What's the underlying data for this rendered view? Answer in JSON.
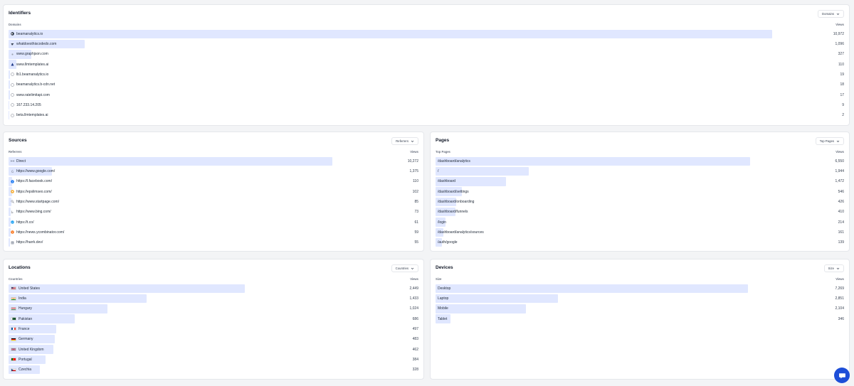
{
  "identifiers": {
    "title": "Identifiers",
    "dropdown": "Domains",
    "col_left": "Domains",
    "col_right": "Views",
    "max": 12000,
    "rows": [
      {
        "label": "beamanalytics.io",
        "value": "10,972",
        "num": 10972,
        "icon": "beam-logo-icon"
      },
      {
        "label": "whatdoesthiscodedo.com",
        "value": "1,096",
        "num": 1096,
        "icon": "whatdoesthiscodedo-logo-icon"
      },
      {
        "label": "www.graphjson.com",
        "value": "327",
        "num": 327,
        "icon": "graphjson-logo-icon"
      },
      {
        "label": "www.llmtemplates.ai",
        "value": "110",
        "num": 110,
        "icon": "llmtemplates-logo-icon"
      },
      {
        "label": "lb1.beamanalytics.io",
        "value": "19",
        "num": 19,
        "icon": "globe-icon"
      },
      {
        "label": "beamanalytics.b-cdn.net",
        "value": "18",
        "num": 18,
        "icon": "globe-icon"
      },
      {
        "label": "www.ratelimitapi.com",
        "value": "17",
        "num": 17,
        "icon": "globe-icon"
      },
      {
        "label": "167.233.14.205",
        "value": "9",
        "num": 9,
        "icon": "globe-icon"
      },
      {
        "label": "beta.llmtemplates.ai",
        "value": "2",
        "num": 2,
        "icon": "globe-icon"
      }
    ]
  },
  "sources": {
    "title": "Sources",
    "dropdown": "Referrers",
    "col_left": "Referrers",
    "col_right": "Views",
    "max": 13000,
    "rows": [
      {
        "label": "Direct",
        "value": "10,272",
        "num": 10272,
        "icon": "link-icon"
      },
      {
        "label": "https://www.google.com/",
        "value": "1,375",
        "num": 1375,
        "icon": "google-icon"
      },
      {
        "label": "https://l.facebook.com/",
        "value": "110",
        "num": 110,
        "icon": "facebook-icon"
      },
      {
        "label": "https://epslimseo.com/",
        "value": "102",
        "num": 102,
        "icon": "epslimseo-icon"
      },
      {
        "label": "https://www.startpage.com/",
        "value": "85",
        "num": 85,
        "icon": "startpage-icon"
      },
      {
        "label": "https://www.bing.com/",
        "value": "73",
        "num": 73,
        "icon": "bing-icon"
      },
      {
        "label": "https://t.co/",
        "value": "61",
        "num": 61,
        "icon": "twitter-icon"
      },
      {
        "label": "https://news.ycombinator.com/",
        "value": "59",
        "num": 59,
        "icon": "ycombinator-icon"
      },
      {
        "label": "https://harrk.dev/",
        "value": "55",
        "num": 55,
        "icon": "harrk-icon"
      }
    ]
  },
  "pages": {
    "title": "Pages",
    "dropdown": "Top Pages",
    "col_left": "Top Pages",
    "col_right": "Views",
    "max": 8500,
    "rows": [
      {
        "label": "/dashboard/analytics",
        "value": "6,550",
        "num": 6550
      },
      {
        "label": "/",
        "value": "1,944",
        "num": 1944
      },
      {
        "label": "/dashboard",
        "value": "1,472",
        "num": 1472
      },
      {
        "label": "/dashboard/settings",
        "value": "546",
        "num": 546
      },
      {
        "label": "/dashboard/onboarding",
        "value": "426",
        "num": 426
      },
      {
        "label": "/dashboard/funnels",
        "value": "410",
        "num": 410
      },
      {
        "label": "/login",
        "value": "214",
        "num": 214
      },
      {
        "label": "/dashboard/analytics/sources",
        "value": "161",
        "num": 161
      },
      {
        "label": "/auth/google",
        "value": "139",
        "num": 139
      }
    ]
  },
  "locations": {
    "title": "Locations",
    "dropdown": "Countries",
    "col_left": "Countries",
    "col_right": "Views",
    "max": 4250,
    "rows": [
      {
        "label": "United States",
        "value": "2,449",
        "num": 2449,
        "flag": "us-flag-icon"
      },
      {
        "label": "India",
        "value": "1,433",
        "num": 1433,
        "flag": "in-flag-icon"
      },
      {
        "label": "Hungary",
        "value": "1,024",
        "num": 1024,
        "flag": "hu-flag-icon"
      },
      {
        "label": "Pakistan",
        "value": "686",
        "num": 686,
        "flag": "pk-flag-icon"
      },
      {
        "label": "France",
        "value": "497",
        "num": 497,
        "flag": "fr-flag-icon"
      },
      {
        "label": "Germany",
        "value": "483",
        "num": 483,
        "flag": "de-flag-icon"
      },
      {
        "label": "United Kingdom",
        "value": "462",
        "num": 462,
        "flag": "gb-flag-icon"
      },
      {
        "label": "Portugal",
        "value": "384",
        "num": 384,
        "flag": "pt-flag-icon"
      },
      {
        "label": "Czechia",
        "value": "328",
        "num": 328,
        "flag": "cz-flag-icon"
      }
    ]
  },
  "devices": {
    "title": "Devices",
    "dropdown": "Size",
    "col_left": "Size",
    "col_right": "Views",
    "max": 9500,
    "rows": [
      {
        "label": "Desktop",
        "value": "7,269",
        "num": 7269
      },
      {
        "label": "Laptop",
        "value": "2,851",
        "num": 2851
      },
      {
        "label": "Mobile",
        "value": "2,104",
        "num": 2104
      },
      {
        "label": "Tablet",
        "value": "346",
        "num": 346
      }
    ]
  },
  "colors": {
    "bar": "#e0e7ff",
    "chat": "#1d4ed8"
  }
}
